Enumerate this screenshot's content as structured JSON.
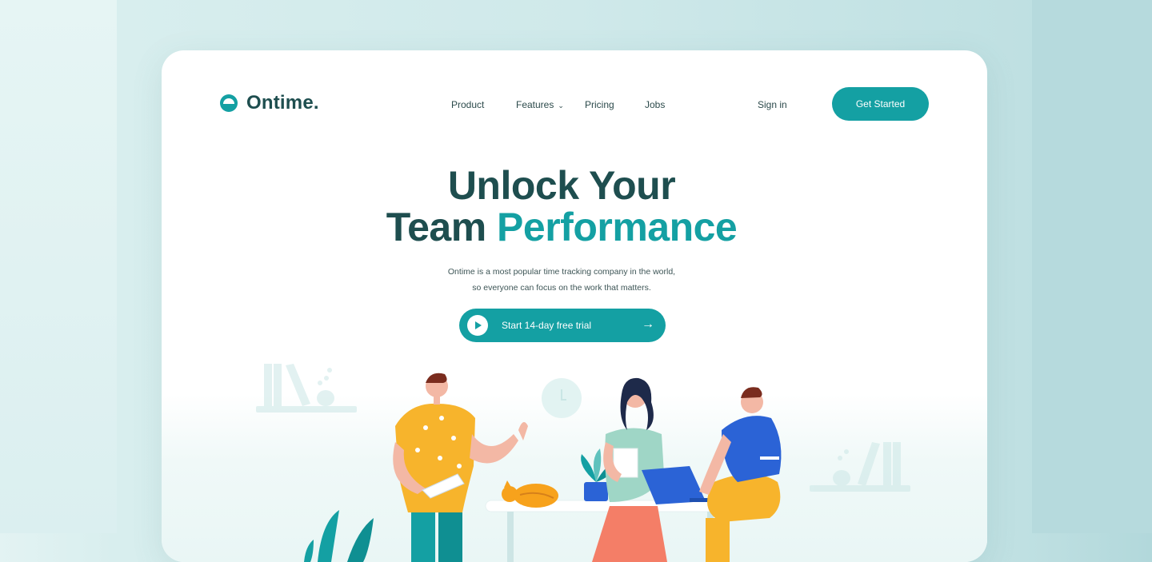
{
  "brand": {
    "name": "Ontime.",
    "accent": "#14a0a3",
    "dark": "#1e4e4f"
  },
  "nav": {
    "items": [
      {
        "label": "Product"
      },
      {
        "label": "Features",
        "icon": "chevron-down-icon"
      },
      {
        "label": "Pricing"
      },
      {
        "label": "Jobs"
      }
    ],
    "signin": "Sign in",
    "cta": "Get Started"
  },
  "hero": {
    "line1": "Unlock Your",
    "line2a": "Team ",
    "line2b": "Performance",
    "sub1": "Ontime is a most popular time tracking company in the world,",
    "sub2": "so everyone can focus on the work that matters.",
    "trial_label": "Start 14-day free trial",
    "trial_icon": "play-icon",
    "trial_arrow": "→"
  },
  "illustration": {
    "description": "team-working-illustration"
  }
}
